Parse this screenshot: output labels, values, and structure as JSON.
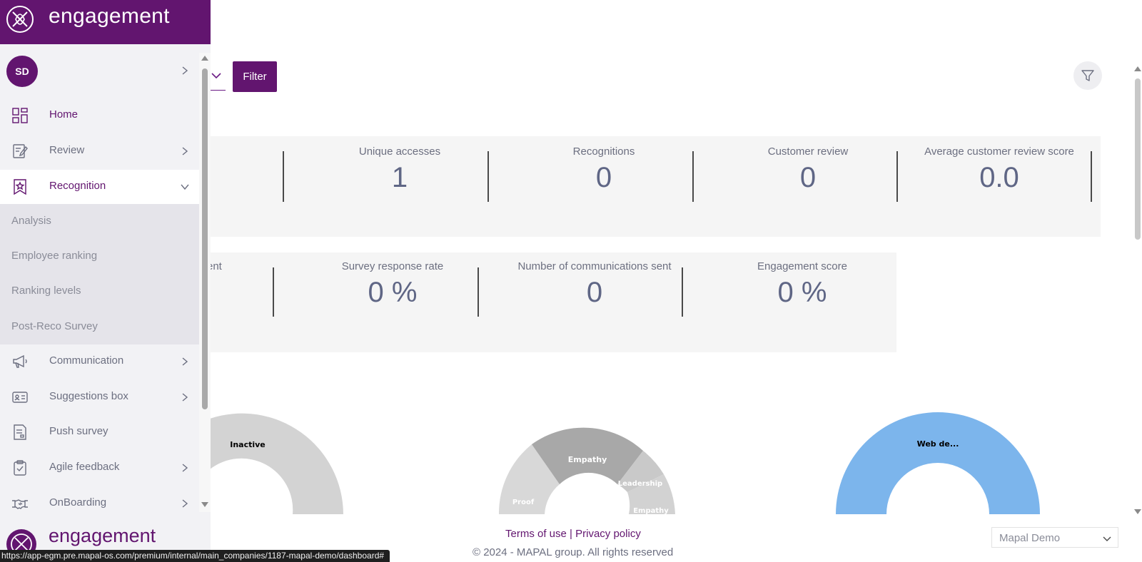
{
  "brand": {
    "name": "engagement",
    "color": "#62156f"
  },
  "user": {
    "initials": "SD"
  },
  "nav": {
    "items": [
      {
        "label": "Home",
        "icon": "grid-icon"
      },
      {
        "label": "Review",
        "icon": "edit-document-icon"
      },
      {
        "label": "Recognition",
        "icon": "bookmark-star-icon"
      },
      {
        "label": "Communication",
        "icon": "megaphone-icon"
      },
      {
        "label": "Suggestions box",
        "icon": "id-card-icon"
      },
      {
        "label": "Push survey",
        "icon": "survey-document-icon"
      },
      {
        "label": "Agile feedback",
        "icon": "clipboard-icon"
      },
      {
        "label": "OnBoarding",
        "icon": "handshake-icon"
      }
    ],
    "recognition_sub": [
      "Analysis",
      "Employee ranking",
      "Ranking levels",
      "Post-Reco Survey"
    ]
  },
  "toolbar": {
    "filter_label": "Filter"
  },
  "kpis_row1": [
    {
      "label": "Unique accesses",
      "value": "1"
    },
    {
      "label": "Recognitions",
      "value": "0"
    },
    {
      "label": "Customer review",
      "value": "0"
    },
    {
      "label": "Average customer review score",
      "value": "0.0"
    }
  ],
  "kpis_row2": [
    {
      "label": "ent",
      "value": ""
    },
    {
      "label": "Survey response rate",
      "value": "0 %"
    },
    {
      "label": "Number of communications sent",
      "value": "0"
    },
    {
      "label": "Engagement score",
      "value": "0 %"
    }
  ],
  "charts": {
    "chart1": {
      "labels": [
        "Inactive"
      ]
    },
    "chart2": {
      "labels": [
        "Empathy",
        "Leadership",
        "Empathy",
        "Proof"
      ]
    },
    "chart3": {
      "labels": [
        "Web de..."
      ],
      "color": "#7cb5ec"
    }
  },
  "footer": {
    "terms": "Terms of use",
    "separator": "|",
    "privacy": "Privacy policy",
    "copyright": "© 2024 - MAPAL group. All rights reserved",
    "company_selected": "Mapal Demo"
  },
  "status_url": "https://app-egm.pre.mapal-os.com/premium/internal/main_companies/1187-mapal-demo/dashboard#"
}
